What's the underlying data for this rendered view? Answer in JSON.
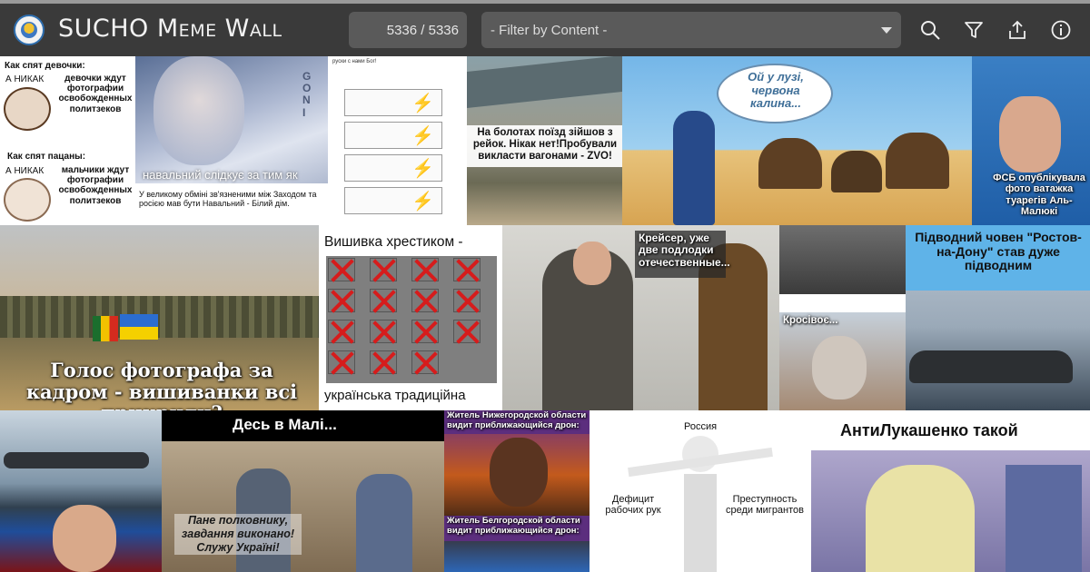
{
  "header": {
    "title": "SUCHO Meme Wall",
    "count": "5336 / 5336",
    "filter_placeholder": "- Filter by Content -"
  },
  "icons": [
    "search-icon",
    "filter-icon",
    "share-icon",
    "info-icon"
  ],
  "colors": {
    "header_bg": "#3a3a3a",
    "field_bg": "#5a5a5a",
    "strip": "#9a9a9a"
  },
  "tiles": {
    "t1": {
      "top": "Как спят девочки:",
      "a": "А НИКАК",
      "b": "девочки ждут фотографии освобожденных политзеков",
      "mid": "Как спят пацаны:",
      "c": "А НИКАК",
      "d": "мальчики ждут фотографии освобожденных политзеков"
    },
    "t2": {
      "caption": "навальний слідкує за тим як",
      "sub": "У великому обміні зв'язненими між Заходом та росією мав бути Навальний - Білий дім."
    },
    "t3": {
      "head": "руски с нами Бог!"
    },
    "t4": {
      "caption": "На болотах поїзд зійшов з рейок. Нікак нет!Пробували викласти вагонами - ZVO!"
    },
    "t5": {
      "bubble": "Ой у лузі, червона калина..."
    },
    "t6": {
      "caption": "ФСБ опублікувала фото ватажка туарегів Аль-Малюкі"
    },
    "t7": {
      "caption": "Голос фотографа за кадром - вишиванки всі прикрили?"
    },
    "t8": {
      "top": "Вишивка хрестиком -",
      "bottom": "українська традиційна"
    },
    "t9": {
      "caption": "Крейсер, уже две подлодки отечественные..."
    },
    "t10": {
      "caption": "Кросівоє..."
    },
    "t11": {
      "caption": "Підводний човен \"Ростов-на-Дону\" став дуже підводним"
    },
    "t13": {
      "caption": "Десь в Малі...",
      "sub": "Пане полковнику, завдання виконано! Служу Україні!"
    },
    "t14": {
      "top": "Житель Нижегородской области видит приближающийся дрон:",
      "bottom": "Житель Белгородской области видит приближающийся дрон:"
    },
    "t15": {
      "top": "Россия",
      "left": "Дефицит рабочих рук",
      "right": "Преступность среди мигрантов"
    },
    "t16": {
      "caption": "АнтиЛукашенко такой"
    }
  }
}
